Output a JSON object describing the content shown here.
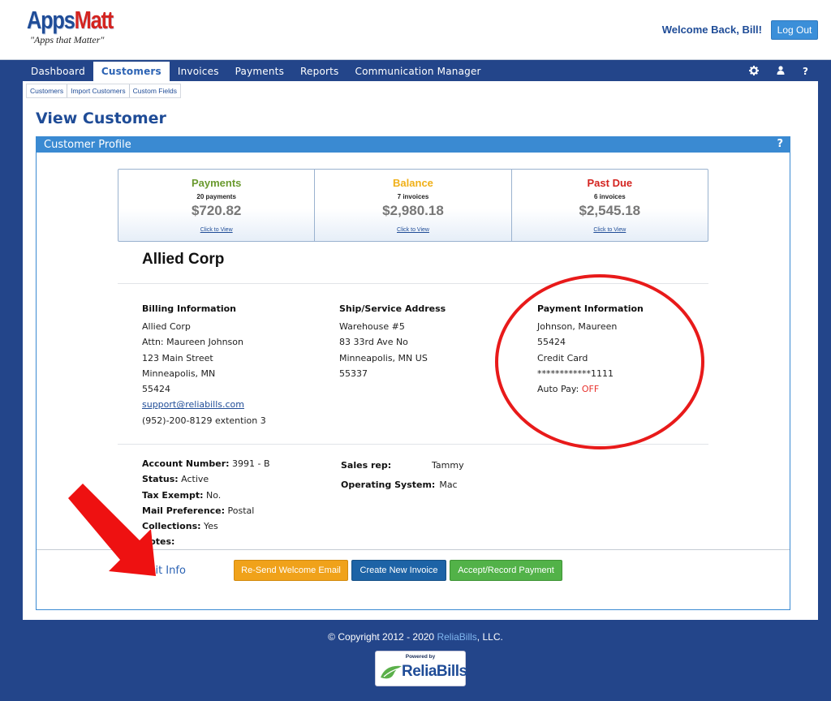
{
  "brand": {
    "name_part1": "Apps",
    "name_part2": "Matt",
    "tagline": "\"Apps that Matter\""
  },
  "header": {
    "welcome": "Welcome Back, Bill!",
    "logout_label": "Log Out"
  },
  "nav": {
    "items": [
      {
        "label": "Dashboard"
      },
      {
        "label": "Customers",
        "active": true
      },
      {
        "label": "Invoices"
      },
      {
        "label": "Payments"
      },
      {
        "label": "Reports"
      },
      {
        "label": "Communication Manager"
      }
    ],
    "icons": [
      "gear-icon",
      "user-icon",
      "help-icon"
    ],
    "help_glyph": "?"
  },
  "subnav": {
    "items": [
      "Customers",
      "Import Customers",
      "Custom Fields"
    ]
  },
  "page": {
    "title": "View Customer"
  },
  "panel": {
    "title": "Customer Profile",
    "help": "?"
  },
  "stats": [
    {
      "title": "Payments",
      "count": "20 payments",
      "amount": "$720.82",
      "link": "Click to View",
      "color": "#6a9a2f"
    },
    {
      "title": "Balance",
      "count": "7 invoices",
      "amount": "$2,980.18",
      "link": "Click to View",
      "color": "#f0b018"
    },
    {
      "title": "Past Due",
      "count": "6 invoices",
      "amount": "$2,545.18",
      "link": "Click to View",
      "color": "#d42420"
    }
  ],
  "customer": {
    "name": "Allied Corp",
    "billing": {
      "heading": "Billing Information",
      "lines": [
        "Allied Corp",
        "Attn: Maureen Johnson",
        "123 Main Street",
        "Minneapolis, MN",
        "55424"
      ],
      "email": "support@reliabills.com",
      "phone": "(952)-200-8129 extention 3"
    },
    "shipping": {
      "heading": "Ship/Service Address",
      "lines": [
        "Warehouse #5",
        "83 33rd Ave No",
        "Minneapolis, MN  US",
        "55337"
      ]
    },
    "payment": {
      "heading": "Payment Information",
      "lines": [
        "Johnson, Maureen",
        "55424",
        "Credit Card",
        "************1111"
      ],
      "autopay_label": "Auto Pay:",
      "autopay_value": "OFF"
    },
    "details": [
      {
        "label": "Account Number:",
        "value": "3991 - B"
      },
      {
        "label": "Status:",
        "value": "Active"
      },
      {
        "label": "Tax Exempt:",
        "value": "No."
      },
      {
        "label": "Mail Preference:",
        "value": "Postal"
      },
      {
        "label": "Collections:",
        "value": "Yes"
      },
      {
        "label": "Notes:",
        "value": ""
      }
    ],
    "extra": [
      {
        "label": "Sales rep:",
        "value": "Tammy"
      },
      {
        "label": "Operating System:",
        "value": "Mac"
      }
    ]
  },
  "actions": {
    "edit_info": "Edit Info",
    "resend_welcome": "Re-Send Welcome Email",
    "create_invoice": "Create New Invoice",
    "record_payment": "Accept/Record Payment"
  },
  "footer": {
    "copyright_pre": "© Copyright 2012 - 2020 ",
    "company": "ReliaBills",
    "copyright_post": ", LLC.",
    "powered_by": "Powered by",
    "powered_name": "ReliaBills"
  },
  "colors": {
    "accent": "#3a8ad2",
    "nav_bg": "#23458a",
    "annotation": "#e81a1a"
  }
}
